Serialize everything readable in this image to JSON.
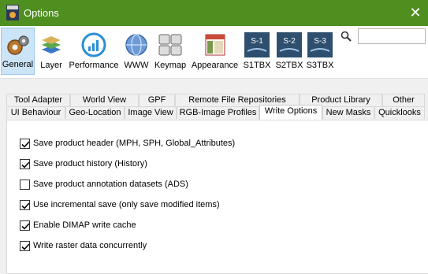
{
  "window": {
    "title": "Options",
    "app_icon": "snap-app-icon",
    "close_icon": "close-icon"
  },
  "toolbar": {
    "items": [
      {
        "label": "General",
        "icon": "gears-icon",
        "selected": true
      },
      {
        "label": "Layer",
        "icon": "layers-icon"
      },
      {
        "label": "Performance",
        "icon": "performance-gauge-icon"
      },
      {
        "label": "WWW",
        "icon": "globe-icon"
      },
      {
        "label": "Keymap",
        "icon": "keyboard-icon"
      },
      {
        "label": "Appearance",
        "icon": "appearance-icon"
      },
      {
        "label": "S1TBX",
        "icon": "s1-icon",
        "badge": "S-1"
      },
      {
        "label": "S2TBX",
        "icon": "s2-icon",
        "badge": "S-2"
      },
      {
        "label": "S3TBX",
        "icon": "s3-icon",
        "badge": "S-3"
      }
    ],
    "search": {
      "placeholder": "",
      "value": ""
    }
  },
  "tabs": {
    "row1": [
      "Tool Adapter",
      "World View",
      "GPF",
      "Remote File Repositories",
      "Product Library",
      "Other"
    ],
    "row2": [
      "UI Behaviour",
      "Geo-Location",
      "Image View",
      "RGB-Image Profiles",
      "Write Options",
      "New Masks",
      "Quicklooks"
    ],
    "active": "Write Options"
  },
  "write_options": [
    {
      "label": "Save product header (MPH, SPH, Global_Attributes)",
      "checked": true
    },
    {
      "label": "Save product history (History)",
      "checked": true
    },
    {
      "label": "Save product annotation datasets (ADS)",
      "checked": false
    },
    {
      "label": "Use incremental save (only save modified items)",
      "checked": true
    },
    {
      "label": "Enable DIMAP write cache",
      "checked": true
    },
    {
      "label": "Write raster data concurrently",
      "checked": true
    }
  ],
  "colors": {
    "titlebar": "#4e8f1f",
    "selected_tool": "#cce4f7"
  }
}
